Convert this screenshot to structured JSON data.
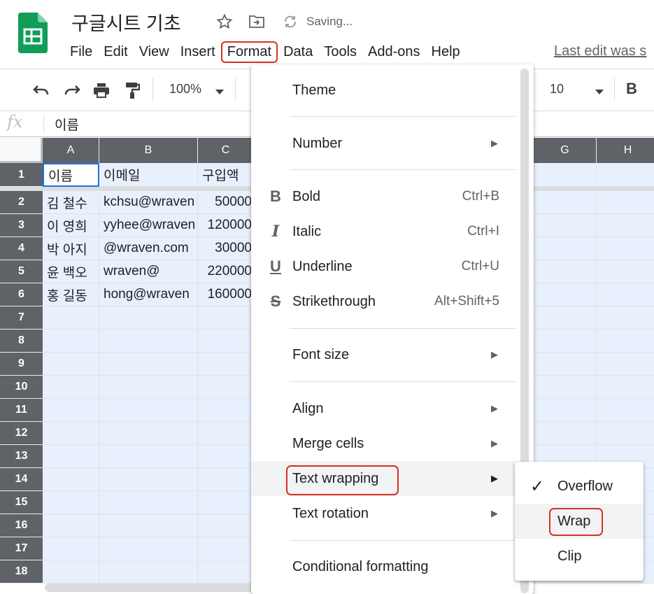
{
  "doc": {
    "title": "구글시트 기초",
    "saving": "Saving..."
  },
  "menubar": [
    "File",
    "Edit",
    "View",
    "Insert",
    "Format",
    "Data",
    "Tools",
    "Add-ons",
    "Help"
  ],
  "last_edit": "Last edit was s",
  "toolbar": {
    "zoom": "100%",
    "font_size": "10",
    "bold": "B"
  },
  "formula": {
    "fx": "fx",
    "value": "이름"
  },
  "columns": [
    "A",
    "B",
    "C",
    "G",
    "H"
  ],
  "rows": [
    "1",
    "2",
    "3",
    "4",
    "5",
    "6",
    "7",
    "8",
    "9",
    "10",
    "11",
    "12",
    "13",
    "14",
    "15",
    "16",
    "17",
    "18"
  ],
  "cells": [
    [
      "이름",
      "이메일",
      "구입액"
    ],
    [
      "김 철수",
      "kchsu@wraven",
      "50000"
    ],
    [
      "이 영희",
      "yyhee@wraven",
      "120000"
    ],
    [
      "박 아지",
      "@wraven.com",
      "30000"
    ],
    [
      "윤 백오",
      "wraven@",
      "220000"
    ],
    [
      "홍 길동",
      "hong@wraven",
      "160000"
    ]
  ],
  "format_menu": {
    "theme": "Theme",
    "number": "Number",
    "bold": "Bold",
    "bold_sc": "Ctrl+B",
    "italic": "Italic",
    "italic_sc": "Ctrl+I",
    "underline": "Underline",
    "underline_sc": "Ctrl+U",
    "strike": "Strikethrough",
    "strike_sc": "Alt+Shift+5",
    "font_size": "Font size",
    "align": "Align",
    "merge": "Merge cells",
    "wrapping": "Text wrapping",
    "rotation": "Text rotation",
    "conditional": "Conditional formatting"
  },
  "wrap_submenu": {
    "overflow": "Overflow",
    "wrap": "Wrap",
    "clip": "Clip"
  },
  "colors": {
    "accent": "#1a73e8",
    "highlight_red": "#d93025",
    "header_gray": "#5f6368",
    "selection": "#e8f0fe",
    "logo_green": "#0f9d58"
  }
}
